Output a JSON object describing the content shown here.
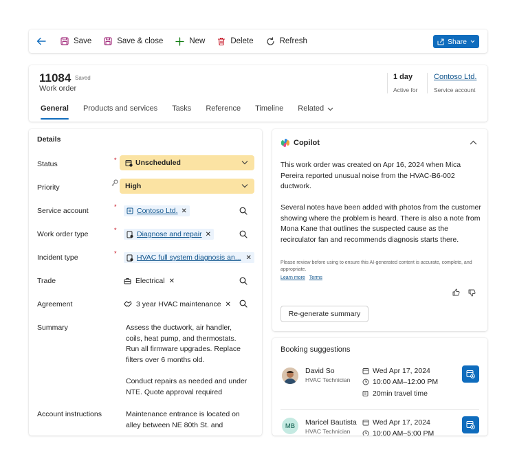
{
  "toolbar": {
    "save_label": "Save",
    "save_close_label": "Save & close",
    "new_label": "New",
    "delete_label": "Delete",
    "refresh_label": "Refresh",
    "share_label": "Share"
  },
  "header": {
    "number": "11084",
    "saved_status": "Saved",
    "entity": "Work order",
    "duration_value": "1 day",
    "duration_label": "Active for",
    "account_value": "Contoso Ltd.",
    "account_label": "Service account",
    "tabs": [
      "General",
      "Products and services",
      "Tasks",
      "Reference",
      "Timeline",
      "Related"
    ]
  },
  "details": {
    "title": "Details",
    "status_label": "Status",
    "status_value": "Unscheduled",
    "priority_label": "Priority",
    "priority_value": "High",
    "service_account_label": "Service account",
    "service_account_value": "Contoso Ltd.",
    "wo_type_label": "Work order type",
    "wo_type_value": "Diagnose and repair",
    "incident_label": "Incident type",
    "incident_value": "HVAC full system diagnosis an...",
    "trade_label": "Trade",
    "trade_value": "Electrical",
    "agreement_label": "Agreement",
    "agreement_value": "3 year HVAC maintenance",
    "summary_label": "Summary",
    "summary_p1": "Assess the ductwork, air handler, coils, heat pump, and thermostats. Run all firmware upgrades. Replace filters over 6 months old.",
    "summary_p2": "Conduct repairs as needed and under NTE. Quote approval required",
    "account_instr_label": "Account instructions",
    "account_instr_value": "Maintenance entrance is located on alley between NE 80th St. and"
  },
  "copilot": {
    "title": "Copilot",
    "p1": "This work order was created on Apr 16, 2024 when Mica Pereira reported unusual noise from the HVAC-B6-002 ductwork.",
    "p2": "Several notes have been added with photos from the customer showing where the problem is heard. There is also a note from Mona Kane that outlines the suspected cause as the recirculator fan and recommends diagnosis starts there.",
    "disclaimer": "Please review before using to ensure this AI-generated content is accurate, complete, and appropriate.",
    "learn_more": "Learn more",
    "terms": "Terms",
    "regen_label": "Re-generate summary"
  },
  "booking": {
    "title": "Booking suggestions",
    "items": [
      {
        "name": "David So",
        "role": "HVAC Technician",
        "date": "Wed Apr 17, 2024",
        "time": "10:00 AM–12:00 PM",
        "travel": "20min travel time",
        "initials": ""
      },
      {
        "name": "Maricel Bautista",
        "role": "HVAC Technician",
        "date": "Wed Apr 17, 2024",
        "time": "10:00 AM–5:00 PM",
        "travel": "",
        "initials": "MB"
      }
    ]
  },
  "colors": {
    "accent": "#0f6cbd",
    "link": "#0f548c",
    "highlight": "#fbe3a3",
    "required": "#c50f1f",
    "toolbar_icon": "#a4317f"
  }
}
